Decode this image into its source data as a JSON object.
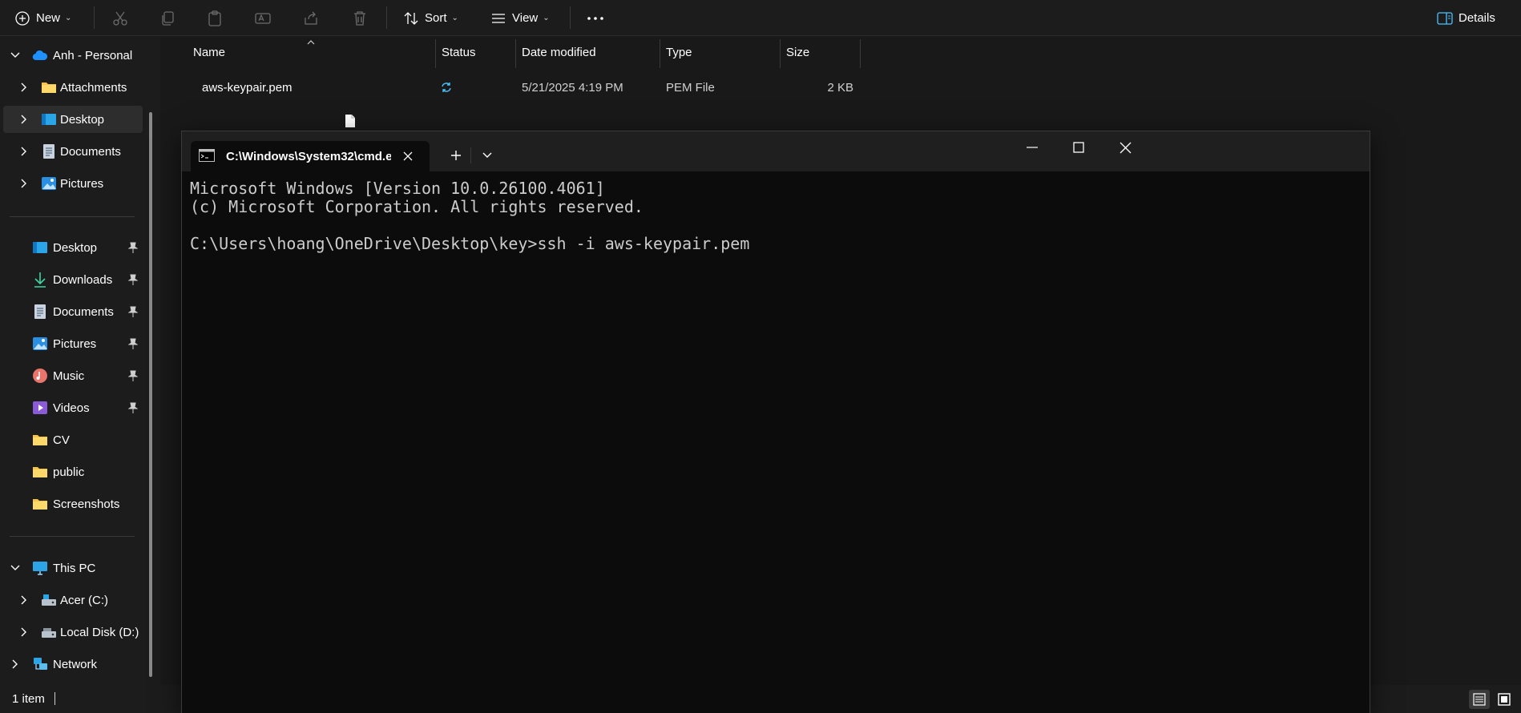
{
  "toolbar": {
    "new_label": "New",
    "sort_label": "Sort",
    "view_label": "View",
    "details_label": "Details"
  },
  "nav": {
    "account": "Anh - Personal",
    "account_children": [
      "Attachments",
      "Desktop",
      "Documents",
      "Pictures"
    ],
    "quick_access": [
      "Desktop",
      "Downloads",
      "Documents",
      "Pictures",
      "Music",
      "Videos",
      "CV",
      "public",
      "Screenshots"
    ],
    "this_pc": "This PC",
    "drives": [
      "Acer (C:)",
      "Local Disk (D:)"
    ],
    "network": "Network"
  },
  "columns": {
    "name": "Name",
    "status": "Status",
    "date": "Date modified",
    "type": "Type",
    "size": "Size"
  },
  "files": [
    {
      "name": "aws-keypair.pem",
      "date": "5/21/2025 4:19 PM",
      "type": "PEM File",
      "size": "2 KB",
      "status_icon": "sync-icon"
    }
  ],
  "status_bar": {
    "count": "1 item"
  },
  "terminal": {
    "tab_title": "C:\\Windows\\System32\\cmd.e",
    "lines": [
      "Microsoft Windows [Version 10.0.26100.4061]",
      "(c) Microsoft Corporation. All rights reserved.",
      "",
      "C:\\Users\\hoang\\OneDrive\\Desktop\\key>ssh -i aws-keypair.pem"
    ]
  },
  "colors": {
    "accent_blue": "#4cc2ff",
    "folder_yellow": "#f8c543",
    "terminal_bg": "#0c0c0c",
    "terminal_text": "#cccccc"
  }
}
